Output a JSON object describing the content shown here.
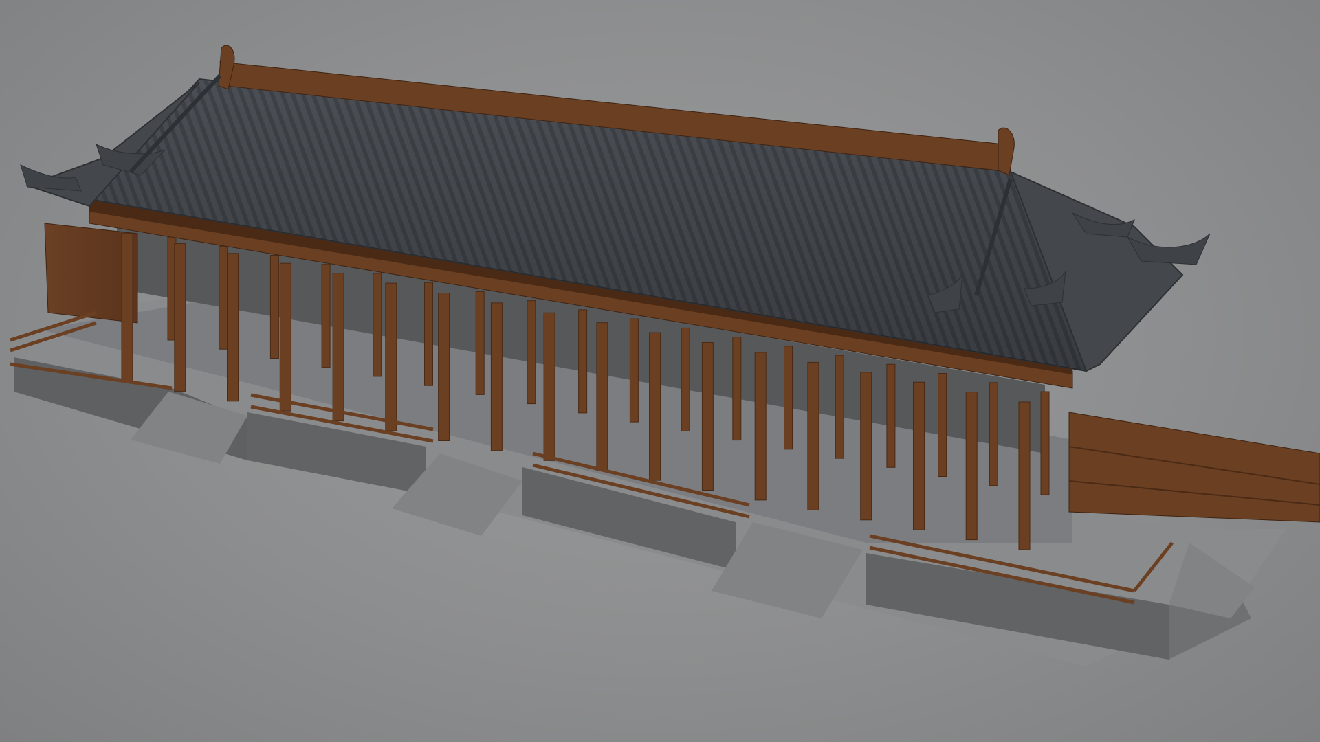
{
  "scene": {
    "subject": "hall-model",
    "colors": {
      "background": "#8e8f90",
      "roof_tile": "#4b4f55",
      "roof_tile_dark": "#3a3d42",
      "roof_ridge": "#6b3f22",
      "timber": "#6a3f22",
      "timber_dark": "#4a2a15",
      "platform_top": "#8a8b8d",
      "platform_side": "#6f7072",
      "platform_front": "#5f6062",
      "floor": "#7c7d80"
    },
    "columns": {
      "front_row_count": 18,
      "inner_row_count": 18
    },
    "stairs_count": 4
  }
}
